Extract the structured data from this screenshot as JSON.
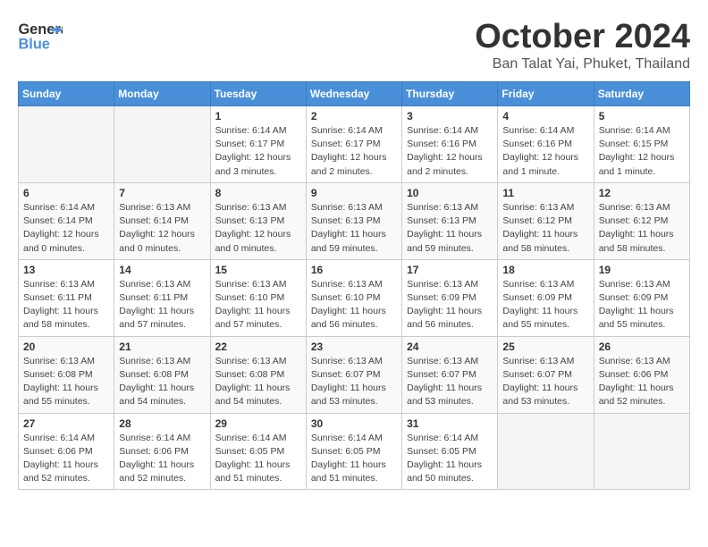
{
  "header": {
    "logo_general": "General",
    "logo_blue": "Blue",
    "month_title": "October 2024",
    "location": "Ban Talat Yai, Phuket, Thailand"
  },
  "days_of_week": [
    "Sunday",
    "Monday",
    "Tuesday",
    "Wednesday",
    "Thursday",
    "Friday",
    "Saturday"
  ],
  "weeks": [
    [
      {
        "day": "",
        "info": ""
      },
      {
        "day": "",
        "info": ""
      },
      {
        "day": "1",
        "info": "Sunrise: 6:14 AM\nSunset: 6:17 PM\nDaylight: 12 hours and 3 minutes."
      },
      {
        "day": "2",
        "info": "Sunrise: 6:14 AM\nSunset: 6:17 PM\nDaylight: 12 hours and 2 minutes."
      },
      {
        "day": "3",
        "info": "Sunrise: 6:14 AM\nSunset: 6:16 PM\nDaylight: 12 hours and 2 minutes."
      },
      {
        "day": "4",
        "info": "Sunrise: 6:14 AM\nSunset: 6:16 PM\nDaylight: 12 hours and 1 minute."
      },
      {
        "day": "5",
        "info": "Sunrise: 6:14 AM\nSunset: 6:15 PM\nDaylight: 12 hours and 1 minute."
      }
    ],
    [
      {
        "day": "6",
        "info": "Sunrise: 6:14 AM\nSunset: 6:14 PM\nDaylight: 12 hours and 0 minutes."
      },
      {
        "day": "7",
        "info": "Sunrise: 6:13 AM\nSunset: 6:14 PM\nDaylight: 12 hours and 0 minutes."
      },
      {
        "day": "8",
        "info": "Sunrise: 6:13 AM\nSunset: 6:13 PM\nDaylight: 12 hours and 0 minutes."
      },
      {
        "day": "9",
        "info": "Sunrise: 6:13 AM\nSunset: 6:13 PM\nDaylight: 11 hours and 59 minutes."
      },
      {
        "day": "10",
        "info": "Sunrise: 6:13 AM\nSunset: 6:13 PM\nDaylight: 11 hours and 59 minutes."
      },
      {
        "day": "11",
        "info": "Sunrise: 6:13 AM\nSunset: 6:12 PM\nDaylight: 11 hours and 58 minutes."
      },
      {
        "day": "12",
        "info": "Sunrise: 6:13 AM\nSunset: 6:12 PM\nDaylight: 11 hours and 58 minutes."
      }
    ],
    [
      {
        "day": "13",
        "info": "Sunrise: 6:13 AM\nSunset: 6:11 PM\nDaylight: 11 hours and 58 minutes."
      },
      {
        "day": "14",
        "info": "Sunrise: 6:13 AM\nSunset: 6:11 PM\nDaylight: 11 hours and 57 minutes."
      },
      {
        "day": "15",
        "info": "Sunrise: 6:13 AM\nSunset: 6:10 PM\nDaylight: 11 hours and 57 minutes."
      },
      {
        "day": "16",
        "info": "Sunrise: 6:13 AM\nSunset: 6:10 PM\nDaylight: 11 hours and 56 minutes."
      },
      {
        "day": "17",
        "info": "Sunrise: 6:13 AM\nSunset: 6:09 PM\nDaylight: 11 hours and 56 minutes."
      },
      {
        "day": "18",
        "info": "Sunrise: 6:13 AM\nSunset: 6:09 PM\nDaylight: 11 hours and 55 minutes."
      },
      {
        "day": "19",
        "info": "Sunrise: 6:13 AM\nSunset: 6:09 PM\nDaylight: 11 hours and 55 minutes."
      }
    ],
    [
      {
        "day": "20",
        "info": "Sunrise: 6:13 AM\nSunset: 6:08 PM\nDaylight: 11 hours and 55 minutes."
      },
      {
        "day": "21",
        "info": "Sunrise: 6:13 AM\nSunset: 6:08 PM\nDaylight: 11 hours and 54 minutes."
      },
      {
        "day": "22",
        "info": "Sunrise: 6:13 AM\nSunset: 6:08 PM\nDaylight: 11 hours and 54 minutes."
      },
      {
        "day": "23",
        "info": "Sunrise: 6:13 AM\nSunset: 6:07 PM\nDaylight: 11 hours and 53 minutes."
      },
      {
        "day": "24",
        "info": "Sunrise: 6:13 AM\nSunset: 6:07 PM\nDaylight: 11 hours and 53 minutes."
      },
      {
        "day": "25",
        "info": "Sunrise: 6:13 AM\nSunset: 6:07 PM\nDaylight: 11 hours and 53 minutes."
      },
      {
        "day": "26",
        "info": "Sunrise: 6:13 AM\nSunset: 6:06 PM\nDaylight: 11 hours and 52 minutes."
      }
    ],
    [
      {
        "day": "27",
        "info": "Sunrise: 6:14 AM\nSunset: 6:06 PM\nDaylight: 11 hours and 52 minutes."
      },
      {
        "day": "28",
        "info": "Sunrise: 6:14 AM\nSunset: 6:06 PM\nDaylight: 11 hours and 52 minutes."
      },
      {
        "day": "29",
        "info": "Sunrise: 6:14 AM\nSunset: 6:05 PM\nDaylight: 11 hours and 51 minutes."
      },
      {
        "day": "30",
        "info": "Sunrise: 6:14 AM\nSunset: 6:05 PM\nDaylight: 11 hours and 51 minutes."
      },
      {
        "day": "31",
        "info": "Sunrise: 6:14 AM\nSunset: 6:05 PM\nDaylight: 11 hours and 50 minutes."
      },
      {
        "day": "",
        "info": ""
      },
      {
        "day": "",
        "info": ""
      }
    ]
  ]
}
